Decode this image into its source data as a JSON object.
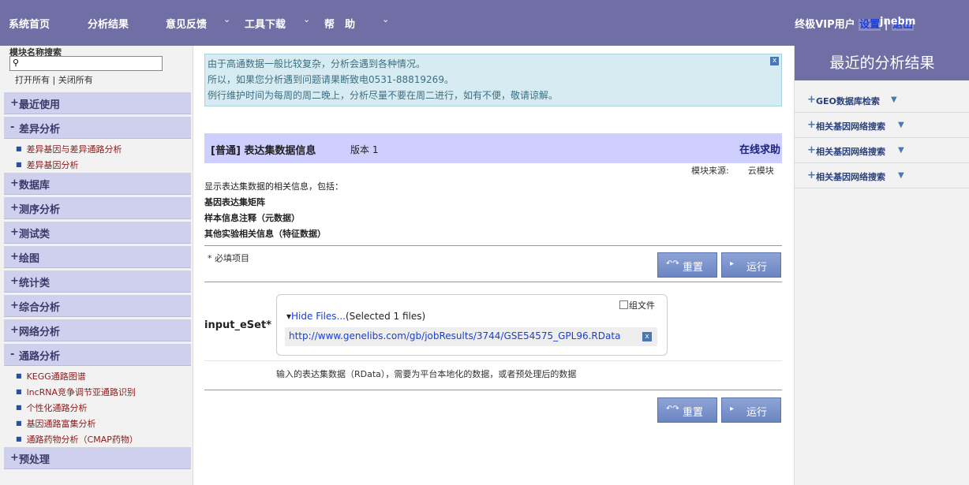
{
  "nav": {
    "home": "系统首页",
    "results": "分析结果",
    "feedback": "意见反馈",
    "tools": "工具下载",
    "help": "帮　助",
    "vip": "终极VIP用户",
    "settings": "设置",
    "sep": "|",
    "logout": "退出",
    "username": "jnebm"
  },
  "sidebar": {
    "search_label": "模块名称搜索",
    "search_placeholder": "",
    "open_all": "打开所有",
    "close_all": "关闭所有",
    "oc_sep": "|",
    "categories": [
      {
        "sym": "+",
        "label": "最近使用"
      },
      {
        "sym": "-",
        "label": "差异分析",
        "items": [
          "差异基因与差异通路分析",
          "差异基因分析"
        ]
      },
      {
        "sym": "+",
        "label": "数据库"
      },
      {
        "sym": "+",
        "label": "测序分析"
      },
      {
        "sym": "+",
        "label": "测试类"
      },
      {
        "sym": "+",
        "label": "绘图"
      },
      {
        "sym": "+",
        "label": "统计类"
      },
      {
        "sym": "+",
        "label": "综合分析"
      },
      {
        "sym": "+",
        "label": "网络分析"
      },
      {
        "sym": "-",
        "label": "通路分析",
        "items": [
          "KEGG通路图谱",
          "lncRNA竞争调节亚通路识别",
          "个性化通路分析",
          "基因通路富集分析",
          "通路药物分析（CMAP药物）"
        ]
      },
      {
        "sym": "+",
        "label": "预处理"
      }
    ]
  },
  "notice": {
    "line1": "由于高通数据一般比较复杂，分析会遇到各种情况。",
    "line2": "所以，如果您分析遇到问题请果断致电0531-88819269。",
    "line3": "例行维护时间为每周的周二晚上，分析尽量不要在周二进行，如有不便，敬请谅解。",
    "close": "x"
  },
  "module": {
    "title": "[普通] 表达集数据信息",
    "version": "版本 1",
    "help": "在线求助",
    "source_label": "模块来源:",
    "source_value": "云模块",
    "desc_intro": "显示表达集数据的相关信息，包括：",
    "desc_items": [
      "基因表达集矩阵",
      "样本信息注释（元数据）",
      "其他实验相关信息（特征数据）"
    ],
    "required": "* 必填项目",
    "reset": "重置",
    "run": "运行",
    "param_label": "input_eSet*",
    "group_files": "组文件",
    "hide_files": "Hide Files...",
    "selected": "(Selected 1 files)",
    "file_url": "http://www.genelibs.com/gb/jobResults/3744/GSE54575_GPL96.RData",
    "file_remove": "x",
    "param_desc": "输入的表达集数据（RData），需要为平台本地化的数据，或者预处理后的数据"
  },
  "rightbar": {
    "title": "最近的分析结果",
    "items": [
      "GEO数据库检索",
      "相关基因网络搜索",
      "相关基因网络搜索",
      "相关基因网络搜索"
    ]
  }
}
